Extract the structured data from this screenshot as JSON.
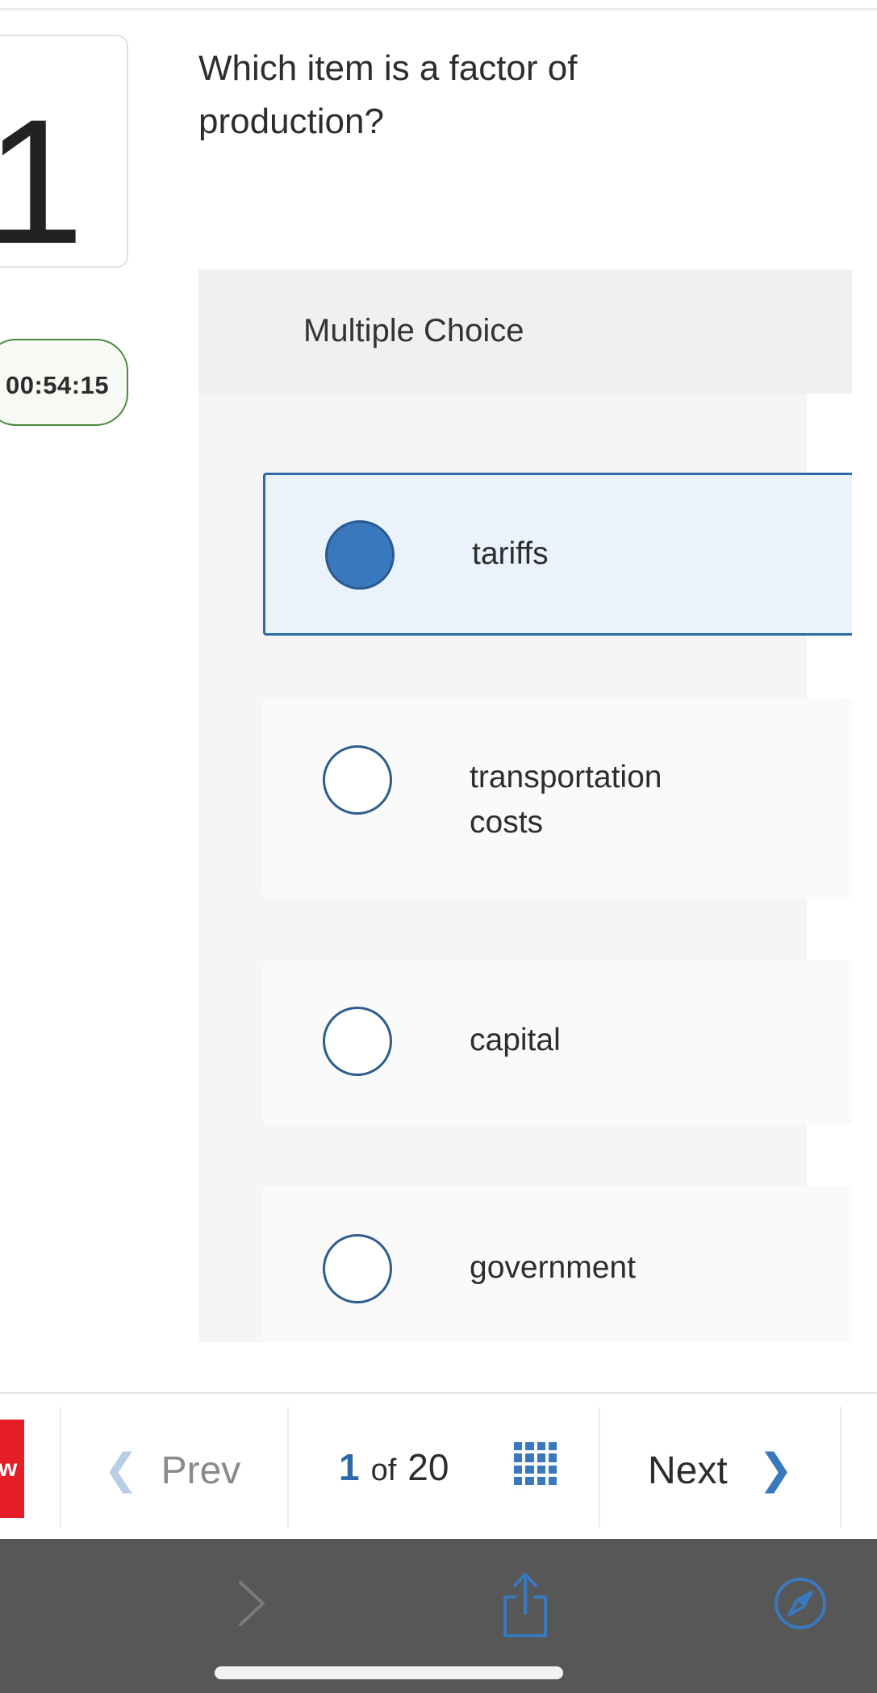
{
  "question": {
    "number": "1",
    "text": "Which item is a factor of production?"
  },
  "timer": "00:54:15",
  "panel": {
    "type_label": "Multiple Choice"
  },
  "choices": [
    {
      "label": "tariffs",
      "selected": true
    },
    {
      "label": "transportation costs",
      "selected": false
    },
    {
      "label": "capital",
      "selected": false
    },
    {
      "label": "government",
      "selected": false
    }
  ],
  "nav": {
    "logo_text": "w",
    "prev_label": "Prev",
    "current_page": "1",
    "of_label": "of",
    "total_pages": "20",
    "next_label": "Next"
  },
  "colors": {
    "accent": "#3a78bd",
    "selected_bg": "#eaf2fb",
    "timer_border": "#4a8a3c",
    "logo_red": "#e51d26",
    "browser_bar": "#575757"
  },
  "icons": [
    "chevron-left-icon",
    "grid-icon",
    "chevron-right-icon",
    "forward-icon",
    "share-icon",
    "compass-icon"
  ]
}
